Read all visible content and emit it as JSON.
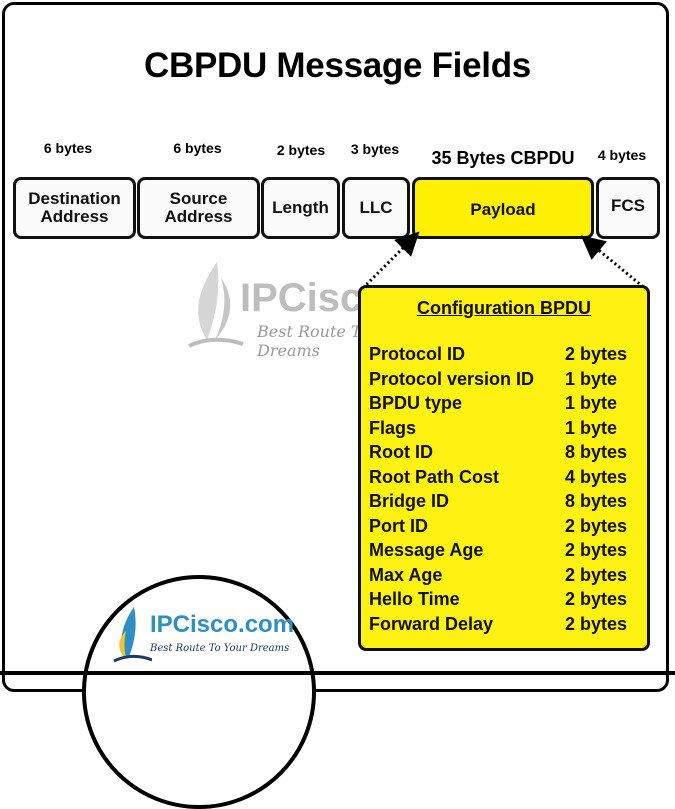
{
  "title": "CBPDU Message Fields",
  "frame_fields": [
    {
      "label": "Destination Address",
      "line1": "Destination",
      "line2": "Address",
      "size": "6 bytes"
    },
    {
      "label": "Source Address",
      "line1": "Source",
      "line2": "Address",
      "size": "6 bytes"
    },
    {
      "label": "Length",
      "line1": "Length",
      "line2": "",
      "size": "2 bytes"
    },
    {
      "label": "LLC",
      "line1": "LLC",
      "line2": "",
      "size": "3 bytes"
    },
    {
      "label": "Payload",
      "line1": "Payload",
      "line2": "",
      "size": "35 Bytes CBPDU"
    },
    {
      "label": "FCS",
      "line1": "FCS",
      "line2": "",
      "size": "4 bytes"
    }
  ],
  "colors": {
    "payload": "#ffef00",
    "config_box": "#fff212",
    "field_bg": "#fafafa",
    "border": "#111111",
    "logo_blue": "#2f8fc4"
  },
  "watermark": {
    "text": "IPCisco.com",
    "tagline": "Best Route To Your Dreams"
  },
  "config_bpdu": {
    "title": "Configuration BPDU",
    "rows": [
      {
        "name": "Protocol ID",
        "size": "2 bytes"
      },
      {
        "name": "Protocol version ID",
        "size": "1 byte"
      },
      {
        "name": "BPDU type",
        "size": "1 byte"
      },
      {
        "name": "Flags",
        "size": "1 byte"
      },
      {
        "name": "Root ID",
        "size": "8 bytes"
      },
      {
        "name": "Root Path Cost",
        "size": "4 bytes"
      },
      {
        "name": "Bridge ID",
        "size": "8 bytes"
      },
      {
        "name": "Port ID",
        "size": "2 bytes"
      },
      {
        "name": "Message Age",
        "size": "2 bytes"
      },
      {
        "name": "Max Age",
        "size": "2 bytes"
      },
      {
        "name": "Hello Time",
        "size": "2 bytes"
      },
      {
        "name": "Forward Delay",
        "size": "2 bytes"
      }
    ]
  },
  "logo": {
    "text": "IPCisco.com",
    "tagline": "Best Route To Your Dreams"
  }
}
